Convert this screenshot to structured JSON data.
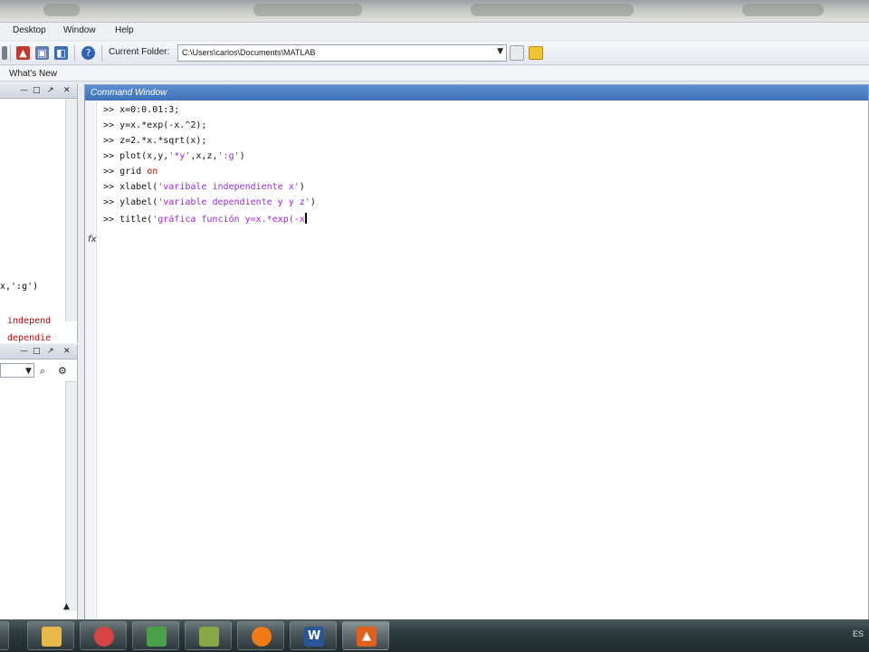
{
  "menubar": {
    "items": [
      "Desktop",
      "Window",
      "Help"
    ]
  },
  "toolbar": {
    "current_folder_label": "Current Folder:",
    "current_folder_path": "C:\\Users\\carlos\\Documents\\MATLAB",
    "icons": [
      "simulink-icon",
      "layout-icon",
      "guide-icon",
      "profiler-icon",
      "help-icon"
    ]
  },
  "shortcuts": {
    "whats_new": "What's New"
  },
  "command_history": {
    "fragments": [
      {
        "text": "x,':g')",
        "color": "#111111"
      },
      {
        "text": "independ",
        "color": "#c80000"
      },
      {
        "text": "dependie",
        "color": "#c80000"
      }
    ]
  },
  "command_window": {
    "title": "Command Window",
    "prompt": ">>",
    "lines": [
      {
        "code": "x=0:0.01:3;"
      },
      {
        "code": "y=x.*exp(-x.^2);"
      },
      {
        "code": "z=2.*x.*sqrt(x);"
      },
      {
        "pre": "plot(x,y,",
        "str": "'*y'",
        "post": ",x,z,",
        "str2": "':g'",
        "post2": ")"
      },
      {
        "pre": "grid ",
        "kw": "on"
      },
      {
        "pre": "xlabel(",
        "str": "'varibale independiente x'",
        "post": ")"
      },
      {
        "pre": "ylabel(",
        "str": "'variable dependiente y y z'",
        "post": ")"
      },
      {
        "pre": "title(",
        "str": "'gráfica función y=x.*exp(-x",
        "post": ""
      }
    ]
  },
  "taskbar": {
    "language": "ES",
    "apps": [
      {
        "name": "explorer-icon",
        "color": "#e8b84a"
      },
      {
        "name": "chrome-icon",
        "color": "#d64541"
      },
      {
        "name": "network-icon",
        "color": "#4c9f4a"
      },
      {
        "name": "notes-icon",
        "color": "#86a845"
      },
      {
        "name": "firefox-icon",
        "color": "#f07a16"
      },
      {
        "name": "word-icon",
        "color": "#2a5699"
      },
      {
        "name": "matlab-icon",
        "color": "#e0601c"
      }
    ]
  }
}
